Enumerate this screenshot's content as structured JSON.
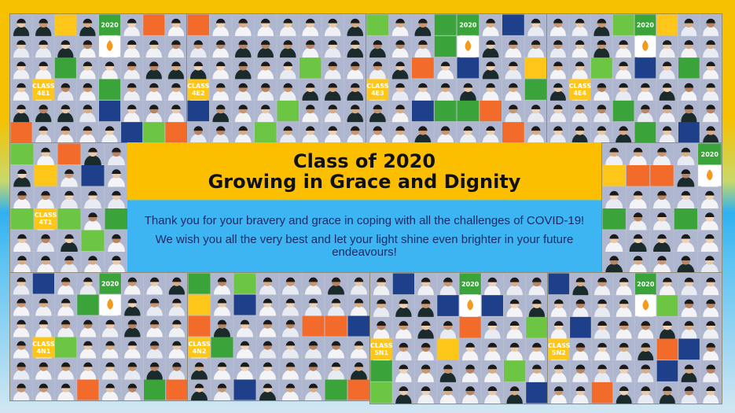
{
  "banner": {
    "title_line1": "Class of 2020",
    "title_line2": "Growing in Grace and Dignity"
  },
  "message": {
    "line1": "Thank you for your bravery and grace in coping with all the challenges of COVID-19!",
    "line2": "We wish you all the very best and let your light shine even brighter in your future endeavours!"
  },
  "collages": [
    {
      "id": "4E1",
      "label": "CLASS 4E1",
      "year": "2020"
    },
    {
      "id": "4E2",
      "label": "CLASS 4E2",
      "year": ""
    },
    {
      "id": "4E3",
      "label": "CLASS 4E3",
      "year": "2020"
    },
    {
      "id": "4E4",
      "label": "CLASS 4E4",
      "year": "2020"
    },
    {
      "id": "4T1",
      "label": "CLASS 4T1",
      "year": ""
    },
    {
      "id": "4T2",
      "label": "",
      "year": "2020"
    },
    {
      "id": "4N1",
      "label": "CLASS 4N1",
      "year": "2020"
    },
    {
      "id": "4N2",
      "label": "CLASS 4N2",
      "year": ""
    },
    {
      "id": "5N1",
      "label": "CLASS 5N1",
      "year": "2020"
    },
    {
      "id": "5N2",
      "label": "CLASS 5N2",
      "year": "2020"
    }
  ],
  "colors": {
    "gold": "#fbbf00",
    "sky": "#3cb5f2",
    "navy": "#1e3f8a",
    "green": "#3aa33a",
    "orange": "#f26b2a",
    "lime": "#6cc644",
    "yellow": "#ffc61a",
    "text": "#1d2a66"
  }
}
